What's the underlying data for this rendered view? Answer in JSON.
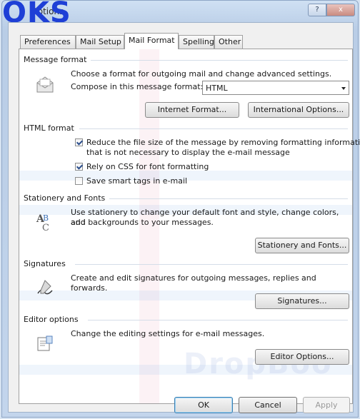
{
  "window": {
    "title": "Options",
    "watermark_title": "OKS",
    "help_label": "?",
    "close_label": "x"
  },
  "tabs": [
    {
      "label": "Preferences"
    },
    {
      "label": "Mail Setup"
    },
    {
      "label": "Mail Format"
    },
    {
      "label": "Spelling"
    },
    {
      "label": "Other"
    }
  ],
  "message_format": {
    "header": "Message format",
    "description": "Choose a format for outgoing mail and change advanced settings.",
    "compose_label": "Compose in this message format:",
    "compose_value": "HTML",
    "internet_format_button": "Internet Format...",
    "international_options_button": "International Options..."
  },
  "html_format": {
    "header": "HTML format",
    "reduce_size_line1": "Reduce the file size of the message by removing formatting information",
    "reduce_size_line2": "that is not necessary to display the e-mail message",
    "reduce_size_checked": true,
    "rely_css_label": "Rely on CSS for font formatting",
    "rely_css_checked": true,
    "smart_tags_label": "Save smart tags in e-mail",
    "smart_tags_checked": false
  },
  "stationery": {
    "header": "Stationery and Fonts",
    "description_line1": "Use stationery to change your default font and style, change colors, and",
    "description_line2": "add backgrounds to your messages.",
    "button": "Stationery and Fonts..."
  },
  "signatures": {
    "header": "Signatures",
    "description": "Create and edit signatures for outgoing messages, replies and forwards.",
    "button": "Signatures..."
  },
  "editor": {
    "header": "Editor options",
    "description": "Change the editing settings for e-mail messages.",
    "button": "Editor Options..."
  },
  "footer": {
    "ok": "OK",
    "cancel": "Cancel",
    "apply": "Apply"
  },
  "watermark": "DropBoo"
}
